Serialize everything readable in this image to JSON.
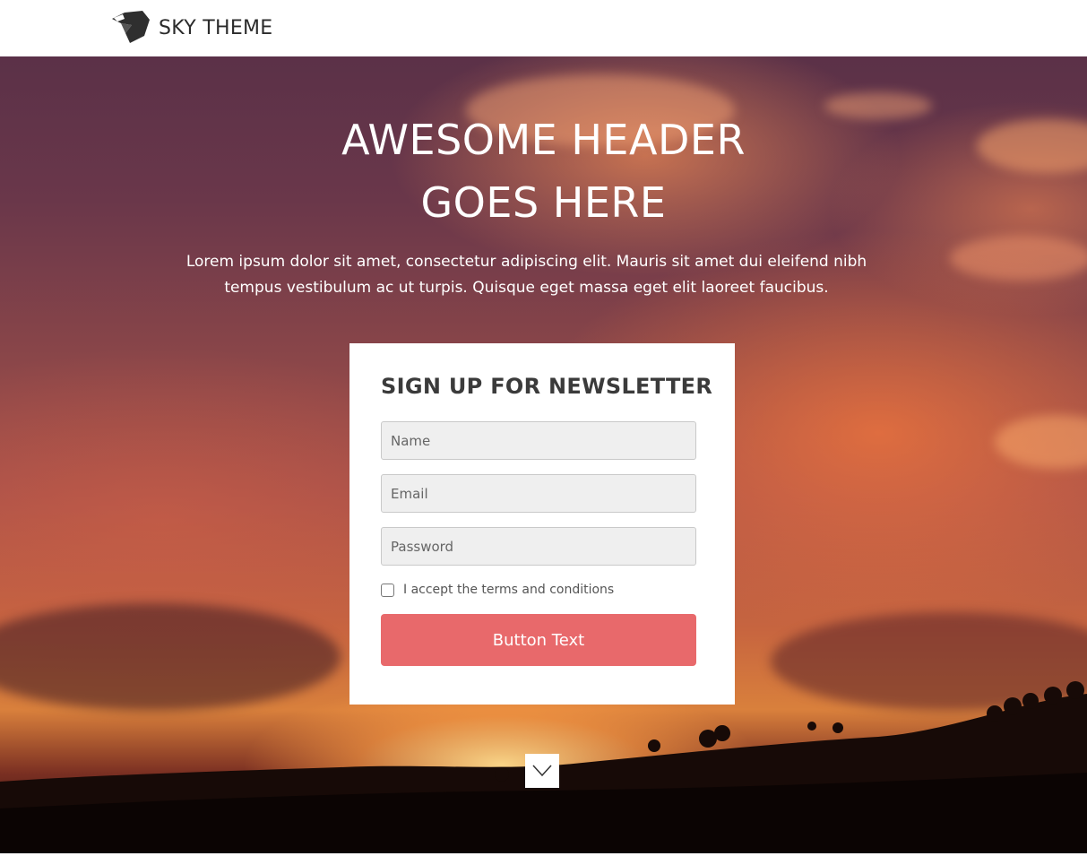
{
  "brand": {
    "name": "SKY THEME",
    "logo_icon": "bird-head-logo-icon"
  },
  "hero": {
    "title": "AWESOME HEADER GOES HERE",
    "text": "Lorem ipsum dolor sit amet, consectetur adipiscing elit. Mauris sit amet dui eleifend nibh tempus vestibulum ac ut turpis. Quisque eget massa eget elit laoreet faucibus."
  },
  "signup": {
    "title": "SIGN UP FOR NEWSLETTER",
    "name_placeholder": "Name",
    "email_placeholder": "Email",
    "password_placeholder": "Password",
    "terms_label": "I accept the terms and conditions",
    "terms_checked": false,
    "button_label": "Button Text"
  },
  "scroll": {
    "icon": "chevron-down-icon"
  },
  "colors": {
    "accent": "#e8696b",
    "card_bg": "#ffffff",
    "input_bg": "#efefef",
    "text_dark": "#3b3b3b"
  }
}
